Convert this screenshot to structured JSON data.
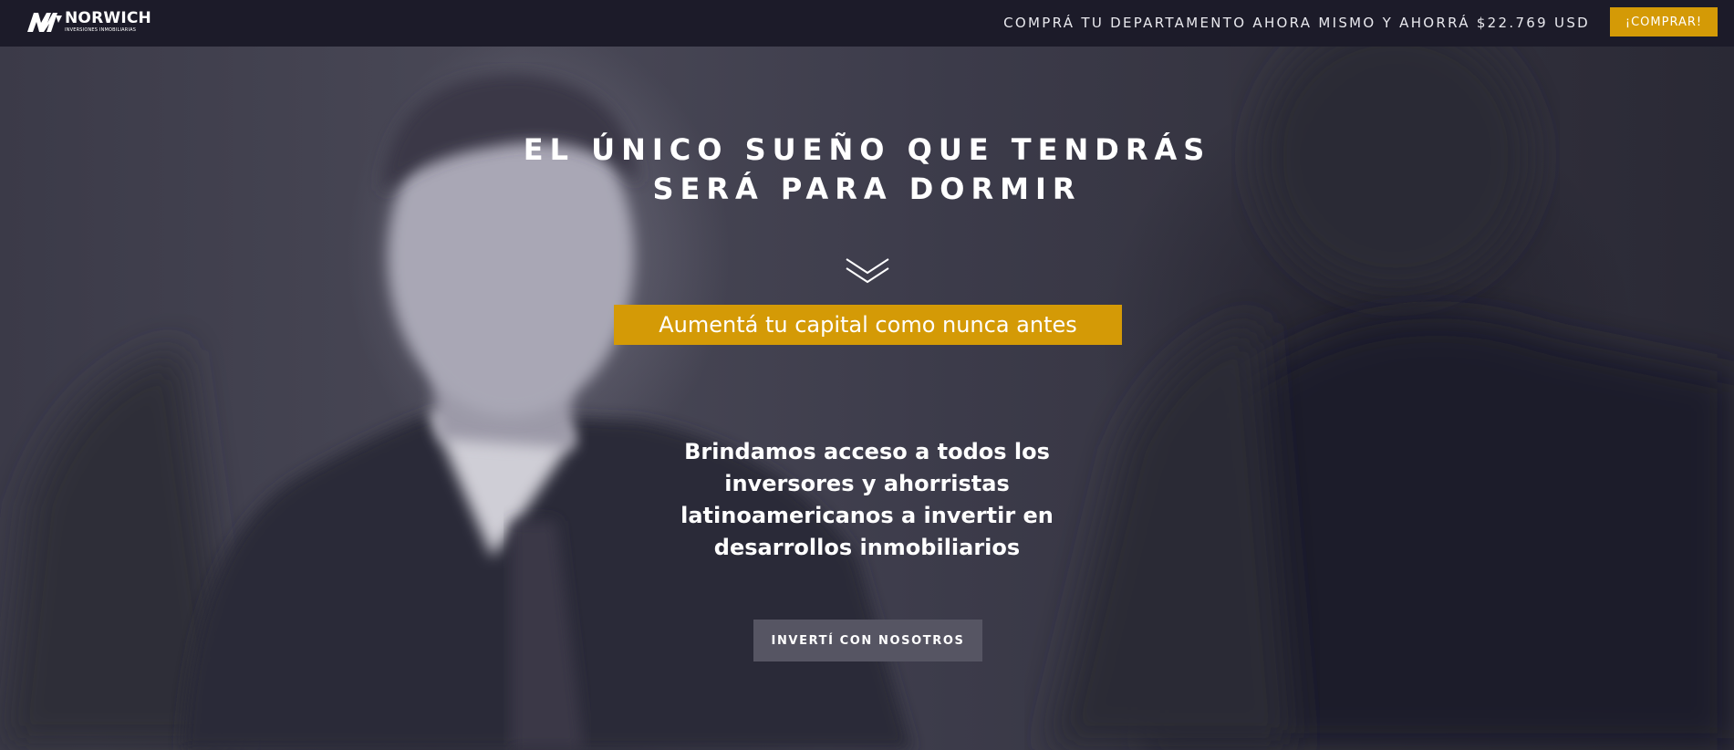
{
  "brand": {
    "name": "NORWICH",
    "subtitle": "INVERSIONES INMOBILIARIAS",
    "logo_icon": "norwich-nw-logo"
  },
  "topbar": {
    "promo_text": "COMPRÁ TU DEPARTAMENTO AHORA MISMO Y AHORRÁ $22.769 USD",
    "buy_label": "¡COMPRAR!"
  },
  "hero": {
    "title_line1": "EL ÚNICO SUEÑO QUE TENDRÁS",
    "title_line2": "SERÁ PARA DORMIR",
    "scroll_icon": "double-chevron-down-icon",
    "tagline": "Aumentá tu capital como nunca antes",
    "description": "Brindamos acceso a todos los inversores y ahorristas latinoamericanos a invertir en desarrollos inmobiliarios",
    "cta_label": "INVERTÍ CON NOSOTROS"
  },
  "colors": {
    "topbar_bg": "#1c1b29",
    "accent": "#d49a06",
    "cta_bg": "#565563",
    "text": "#ffffff"
  }
}
